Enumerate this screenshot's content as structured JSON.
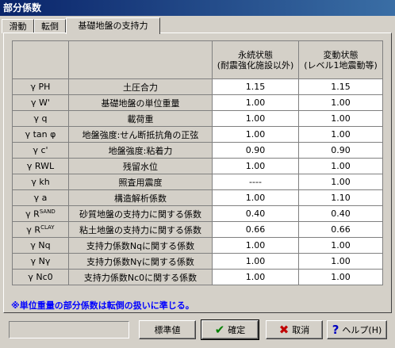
{
  "window": {
    "title": "部分係数"
  },
  "tabs": [
    {
      "label": "滑動",
      "active": false
    },
    {
      "label": "転倒",
      "active": false
    },
    {
      "label": "基礎地盤の支持力",
      "active": true
    }
  ],
  "table": {
    "headers": {
      "sym": "",
      "desc": "",
      "perm_line1": "永続状態",
      "perm_line2": "(耐震強化施設以外)",
      "quake_line1": "変動状態",
      "quake_line2": "(レベル1地震動等)"
    },
    "rows": [
      {
        "sym": "γ PH",
        "desc": "土圧合力",
        "perm": "1.15",
        "quake": "1.15"
      },
      {
        "sym": "γ W'",
        "desc": "基礎地盤の単位重量",
        "perm": "1.00",
        "quake": "1.00"
      },
      {
        "sym": "γ q",
        "desc": "載荷重",
        "perm": "1.00",
        "quake": "1.00"
      },
      {
        "sym": "γ tan φ",
        "desc": "地盤強度:せん断抵抗角の正弦",
        "perm": "1.00",
        "quake": "1.00"
      },
      {
        "sym": "γ c'",
        "desc": "地盤強度:粘着力",
        "perm": "0.90",
        "quake": "0.90"
      },
      {
        "sym": "γ RWL",
        "desc": "残留水位",
        "perm": "1.00",
        "quake": "1.00"
      },
      {
        "sym": "γ kh",
        "desc": "照査用震度",
        "perm": "----",
        "quake": "1.00"
      },
      {
        "sym": "γ a",
        "desc": "構造解析係数",
        "perm": "1.00",
        "quake": "1.10"
      },
      {
        "sym": "γ R",
        "sup": "SAND",
        "desc": "砂質地盤の支持力に関する係数",
        "perm": "0.40",
        "quake": "0.40"
      },
      {
        "sym": "γ R",
        "sup": "CLAY",
        "desc": "粘土地盤の支持力に関する係数",
        "perm": "0.66",
        "quake": "0.66"
      },
      {
        "sym": "γ Nq",
        "desc": "支持力係数Nqに関する係数",
        "perm": "1.00",
        "quake": "1.00"
      },
      {
        "sym": "γ Nγ",
        "desc": "支持力係数Nγに関する係数",
        "perm": "1.00",
        "quake": "1.00"
      },
      {
        "sym": "γ Nc0",
        "desc": "支持力係数Nc0に関する係数",
        "perm": "1.00",
        "quake": "1.00"
      }
    ]
  },
  "note": "※単位重量の部分係数は転倒の扱いに準じる。",
  "status": "",
  "buttons": {
    "standard": "標準値",
    "ok": "確定",
    "cancel": "取消",
    "help": "ヘルプ(H)"
  },
  "icons": {
    "ok": "check-icon",
    "cancel": "x-icon",
    "help": "question-icon"
  },
  "colors": {
    "title_start": "#0a246a",
    "title_end": "#3a6ea5",
    "note": "#0000ff",
    "ok_icon": "#008000",
    "cancel_icon": "#c00000",
    "help_icon": "#0000c0"
  }
}
